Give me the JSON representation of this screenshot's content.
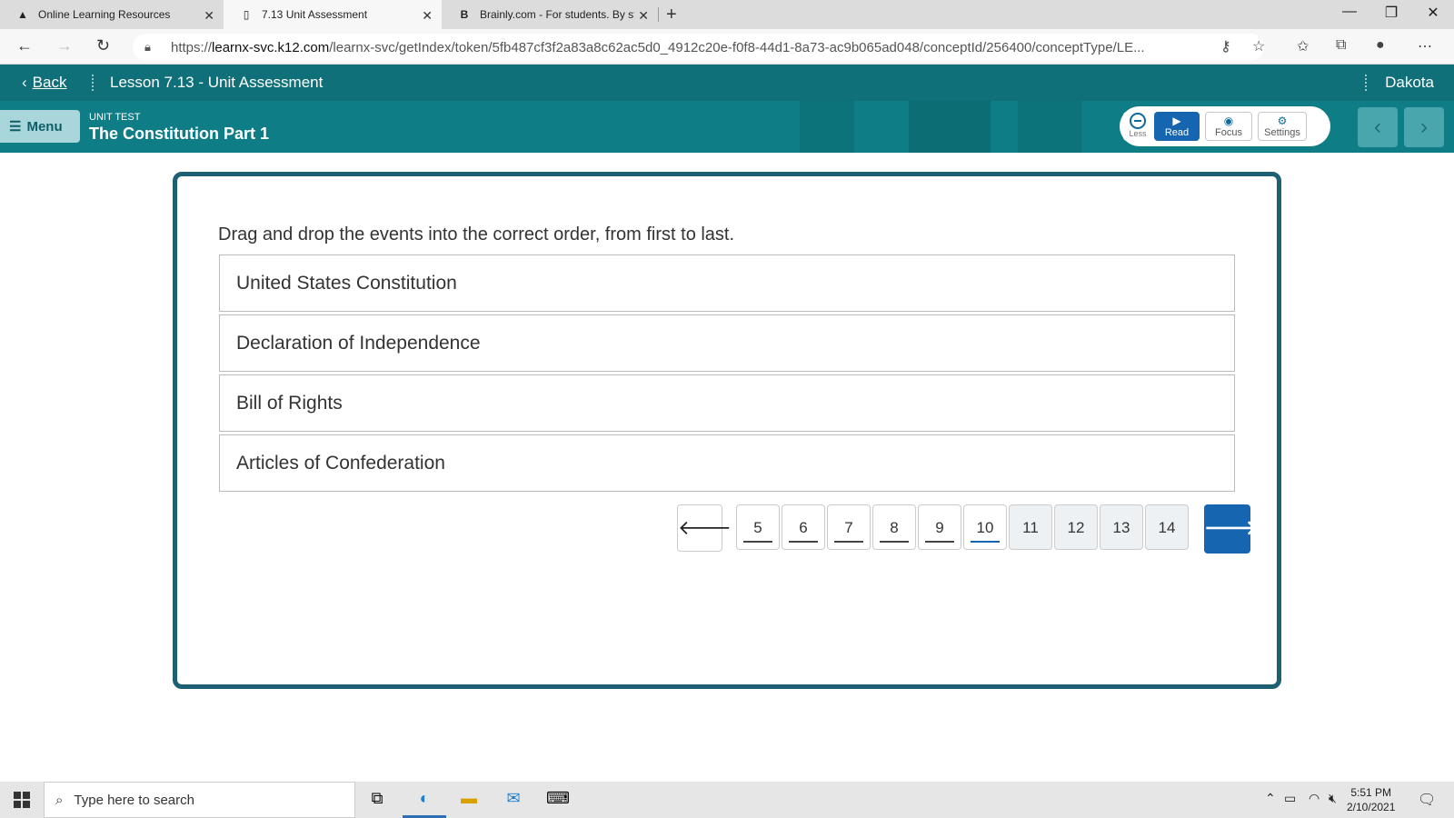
{
  "browser": {
    "tabs": [
      {
        "label": "Online Learning Resources",
        "icon": "tree-icon",
        "active": false
      },
      {
        "label": "7.13 Unit Assessment",
        "icon": "page-icon",
        "active": true
      },
      {
        "label": "Brainly.com - For students. By st",
        "icon": "brainly-icon",
        "active": false
      }
    ],
    "new_tab_glyph": "+",
    "url_scheme": "https://",
    "url_host": "learnx-svc.k12.com",
    "url_path": "/learnx-svc/getIndex/token/5fb487cf3f2a83a8c62ac5d0_4912c20e-f0f8-44d1-8a73-ac9b065ad048/conceptId/256400/conceptType/LE..."
  },
  "app": {
    "back_label": "Back",
    "lesson_title": "Lesson 7.13 - Unit Assessment",
    "user_name": "Dakota",
    "menu_label": "Menu",
    "unit_kicker": "UNIT TEST",
    "unit_title": "The Constitution Part 1",
    "tools": {
      "less_label": "Less",
      "read_label": "Read",
      "focus_label": "Focus",
      "settings_label": "Settings"
    }
  },
  "question": {
    "prompt": "Drag and drop the events into the correct order, from first to last.",
    "items": [
      "United States Constitution",
      "Declaration of Independence",
      "Bill of Rights",
      "Articles of Confederation"
    ]
  },
  "pager": {
    "pages": [
      "5",
      "6",
      "7",
      "8",
      "9",
      "10",
      "11",
      "12",
      "13",
      "14"
    ],
    "current": "10"
  },
  "taskbar": {
    "search_placeholder": "Type here to search",
    "time": "5:51 PM",
    "date": "2/10/2021"
  },
  "colors": {
    "header_teal": "#10707a",
    "card_border": "#1f5f73",
    "primary_blue": "#1565b0"
  }
}
